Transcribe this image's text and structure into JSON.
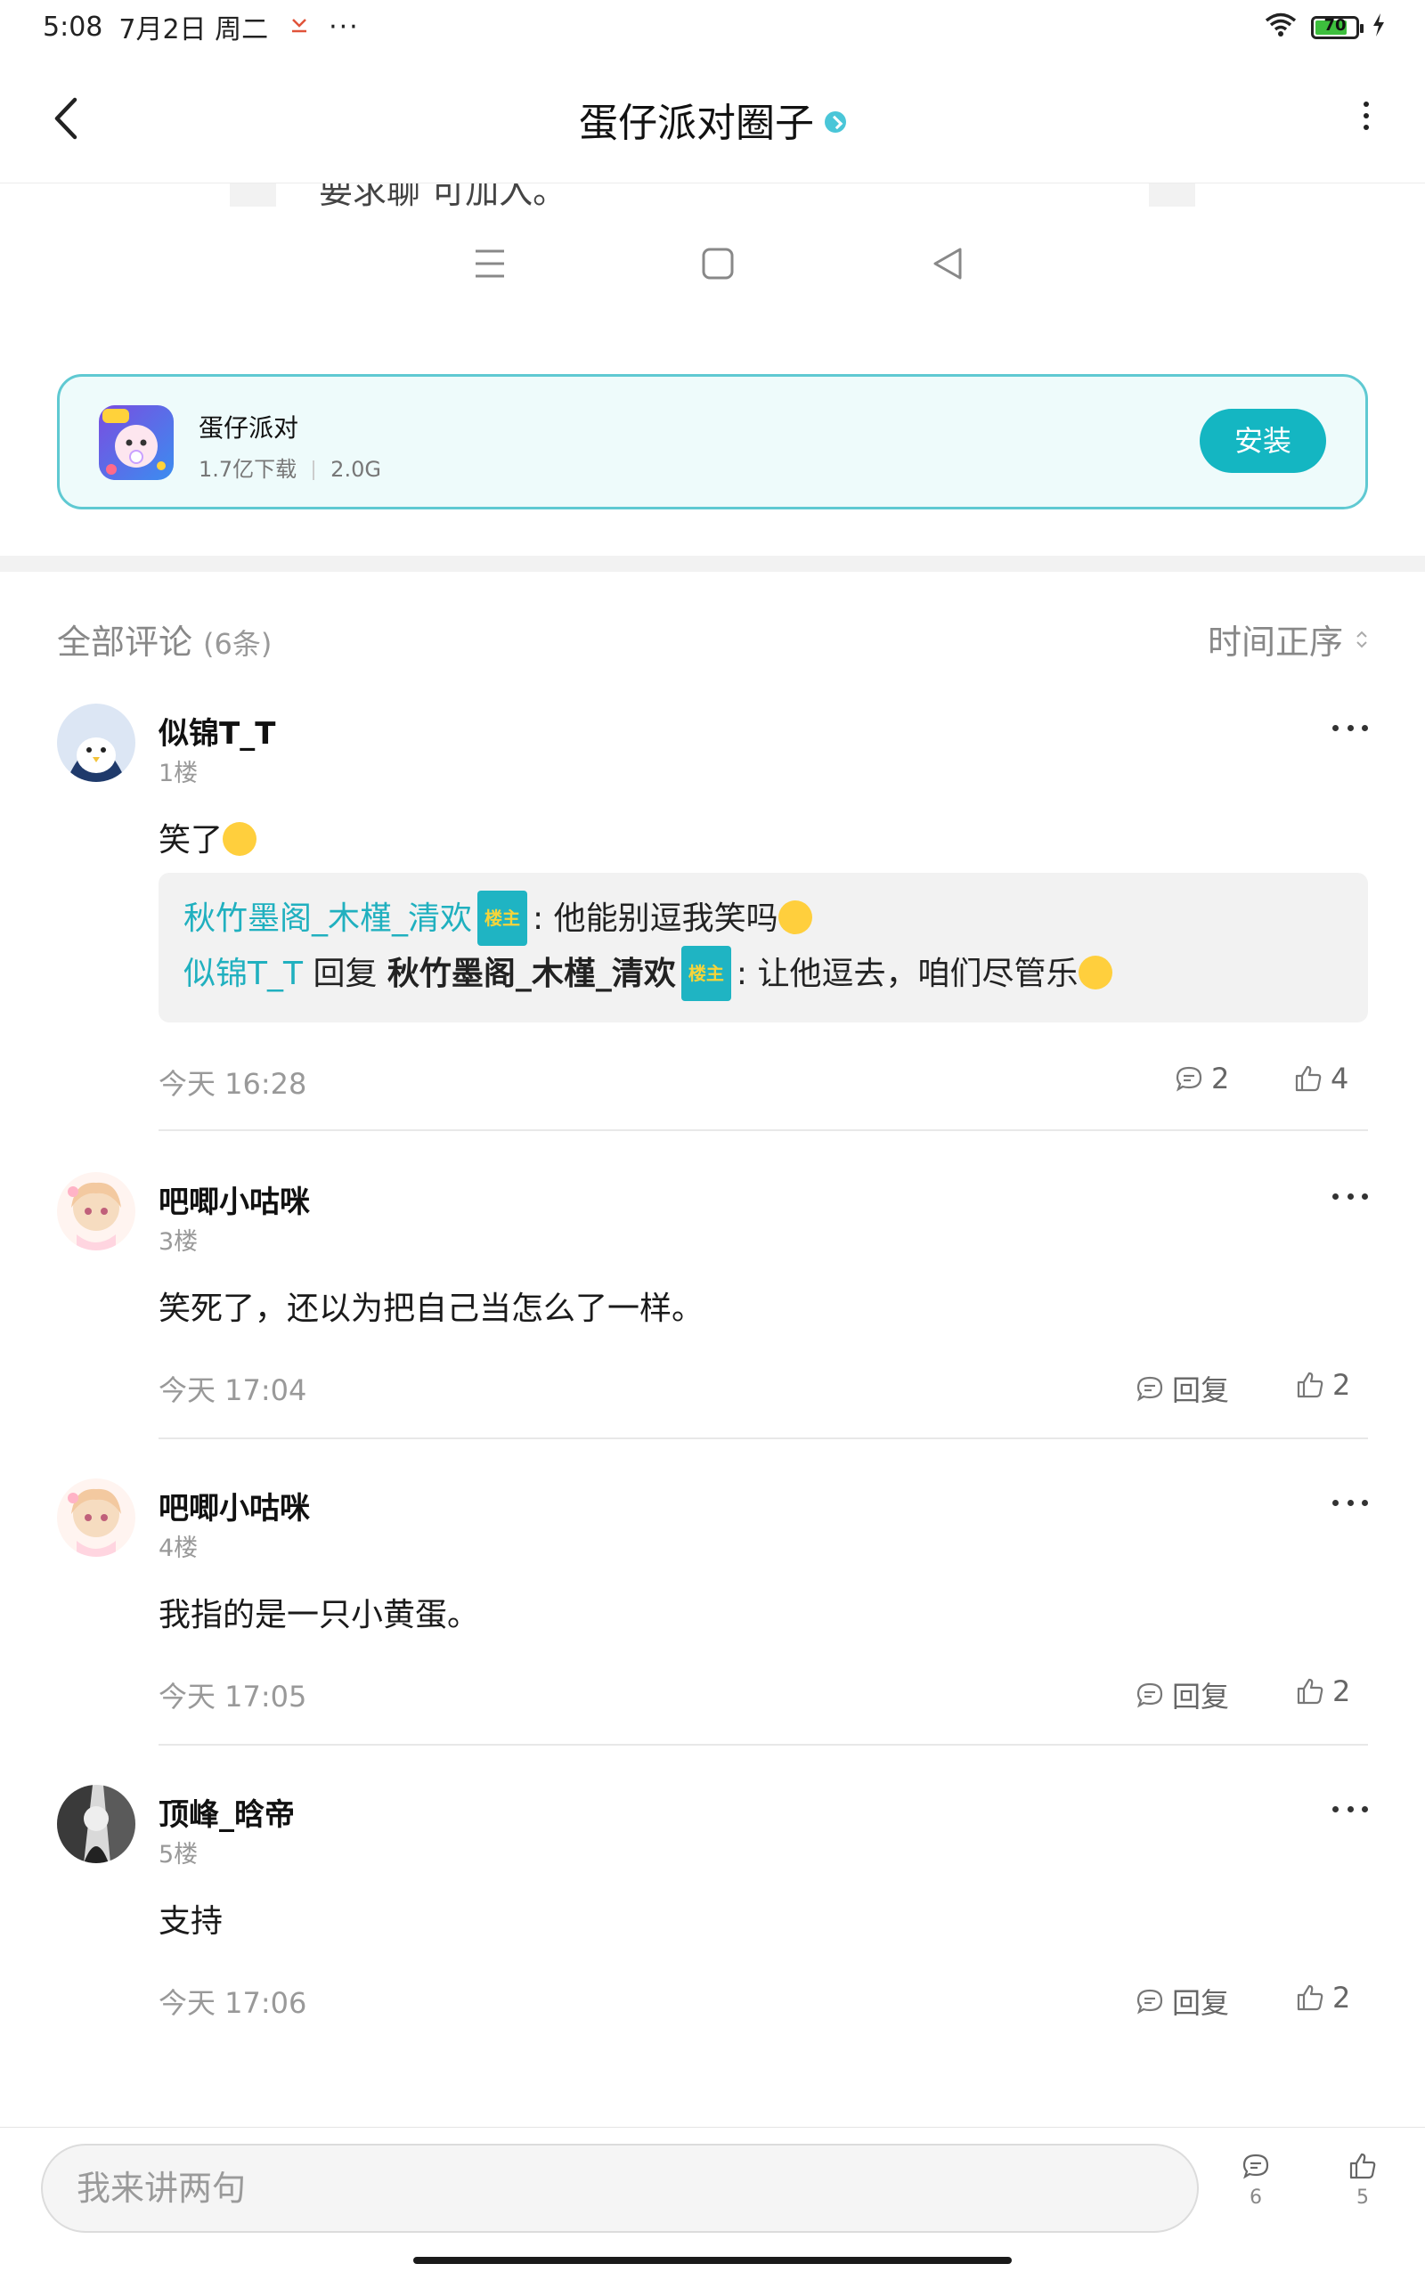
{
  "status_bar": {
    "time": "5:08",
    "date": "7月2日 周二",
    "more": "···",
    "battery": "70"
  },
  "header": {
    "title": "蛋仔派对圈子"
  },
  "embedded": {
    "partial_text": "要求聊 可加入。"
  },
  "app_card": {
    "name": "蛋仔派对",
    "downloads": "1.7亿下载",
    "size": "2.0G",
    "install_label": "安装",
    "accent": "#14b6c2"
  },
  "comments_section": {
    "title": "全部评论",
    "count": "(6条)",
    "sort_label": "时间正序"
  },
  "comments": [
    {
      "user": "似锦T_T",
      "floor": "1楼",
      "text": "笑了",
      "time": "今天 16:28",
      "reply_count": "2",
      "likes": "4",
      "replies": [
        {
          "from": "秋竹墨阁_木槿_清欢",
          "badge": "楼主",
          "text": "他能别逗我笑吗"
        },
        {
          "from": "似锦T_T",
          "reply_word": "回复",
          "to": "秋竹墨阁_木槿_清欢",
          "badge": "楼主",
          "text": "让他逗去，咱们尽管乐"
        }
      ]
    },
    {
      "user": "吧唧小咕咪",
      "floor": "3楼",
      "text": "笑死了，还以为把自己当怎么了一样。",
      "time": "今天 17:04",
      "reply_label": "回复",
      "likes": "2"
    },
    {
      "user": "吧唧小咕咪",
      "floor": "4楼",
      "text": "我指的是一只小黄蛋。",
      "time": "今天 17:05",
      "reply_label": "回复",
      "likes": "2"
    },
    {
      "user": "顶峰_晗帝",
      "floor": "5楼",
      "text": "支持",
      "time": "今天 17:06",
      "reply_label": "回复",
      "likes": "2"
    }
  ],
  "bottom_bar": {
    "input_placeholder": "我来讲两句",
    "comment_count": "6",
    "like_count": "5"
  }
}
